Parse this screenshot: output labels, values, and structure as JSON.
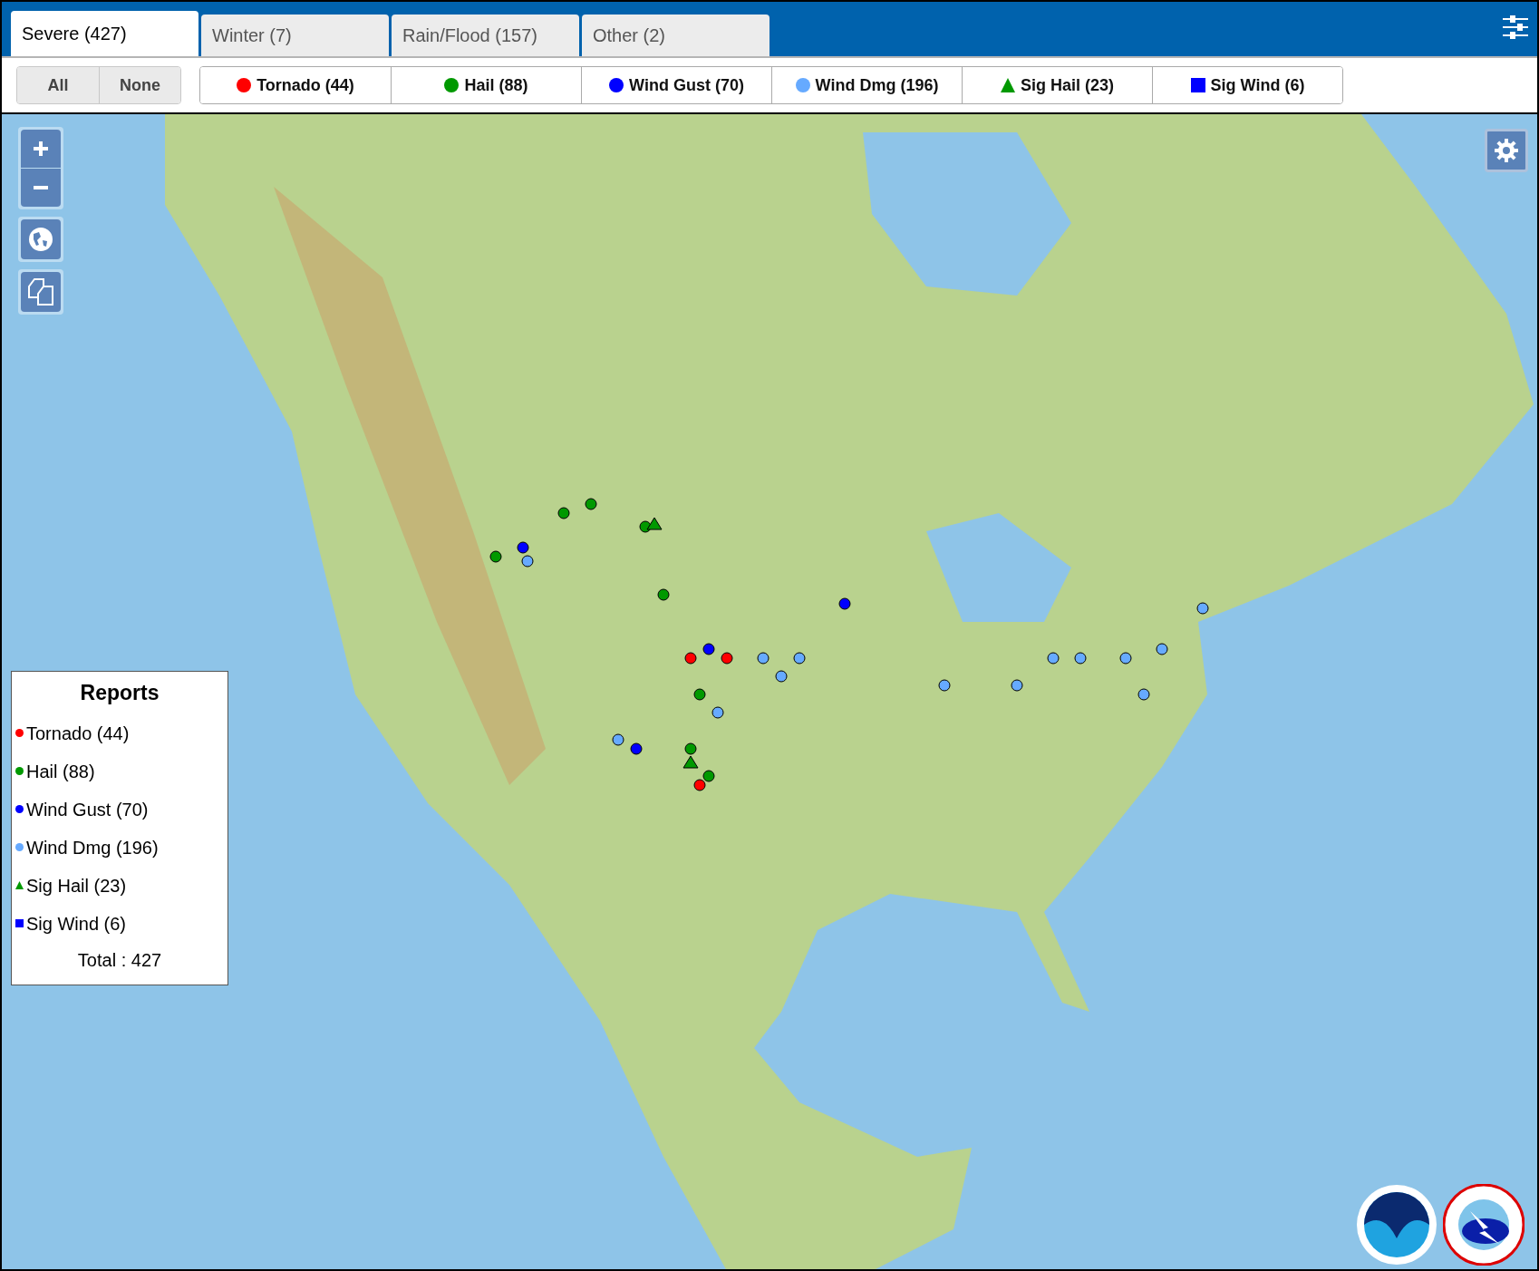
{
  "tabs": [
    {
      "label": "Severe (427)",
      "selected": true
    },
    {
      "label": "Winter (7)",
      "selected": false
    },
    {
      "label": "Rain/Flood (157)",
      "selected": false
    },
    {
      "label": "Other (2)",
      "selected": false
    }
  ],
  "filter_buttons": [
    "All",
    "None"
  ],
  "categories": [
    {
      "label": "Tornado (44)",
      "kind": "circle",
      "color": "#ff0000"
    },
    {
      "label": "Hail (88)",
      "kind": "circle",
      "color": "#009900"
    },
    {
      "label": "Wind Gust (70)",
      "kind": "circle",
      "color": "#0000ff"
    },
    {
      "label": "Wind Dmg (196)",
      "kind": "circle",
      "color": "#66aaff"
    },
    {
      "label": "Sig Hail (23)",
      "kind": "triangle",
      "color": "#009900"
    },
    {
      "label": "Sig Wind (6)",
      "kind": "square",
      "color": "#0000ff"
    }
  ],
  "legend": {
    "title": "Reports",
    "items": [
      {
        "label": "Tornado (44)",
        "kind": "circle",
        "color": "#ff0000"
      },
      {
        "label": "Hail (88)",
        "kind": "circle",
        "color": "#009900"
      },
      {
        "label": "Wind Gust (70)",
        "kind": "circle",
        "color": "#0000ff"
      },
      {
        "label": "Wind Dmg (196)",
        "kind": "circle",
        "color": "#66aaff"
      },
      {
        "label": "Sig Hail (23)",
        "kind": "triangle",
        "color": "#009900"
      },
      {
        "label": "Sig Wind (6)",
        "kind": "square",
        "color": "#0000ff"
      }
    ],
    "total": "Total : 427"
  }
}
